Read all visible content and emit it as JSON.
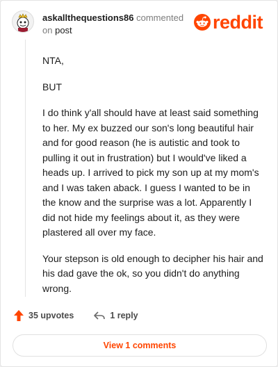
{
  "comment": {
    "username": "askallthequestions86",
    "action_text": "commented",
    "on_text": "on",
    "post_link": "post",
    "paragraphs": [
      "NTA,",
      "BUT",
      "I do think y'all should have at least said something to her. My ex buzzed our son's long beautiful hair and for good reason (he is autistic and took to pulling it out in frustration) but I would've liked a heads up. I arrived to pick my son up at my mom's and I was taken aback. I guess I wanted to be in the know and the surprise was a lot. Apparently I did not hide my feelings about it, as they were plastered all over my face.",
      "Your stepson is old enough to decipher his hair and his dad gave the ok, so you didn't do anything wrong."
    ],
    "upvotes_label": "35 upvotes",
    "reply_label": "1 reply",
    "view_comments_label": "View 1 comments"
  },
  "logo": {
    "text": "reddit",
    "icon": "reddit-alien-icon"
  },
  "icons": {
    "upvote": "upvote-arrow-icon",
    "reply": "reply-arrow-icon"
  },
  "colors": {
    "brand": "#ff4500",
    "text": "#1c1c1c",
    "muted": "#7c7c7c"
  }
}
